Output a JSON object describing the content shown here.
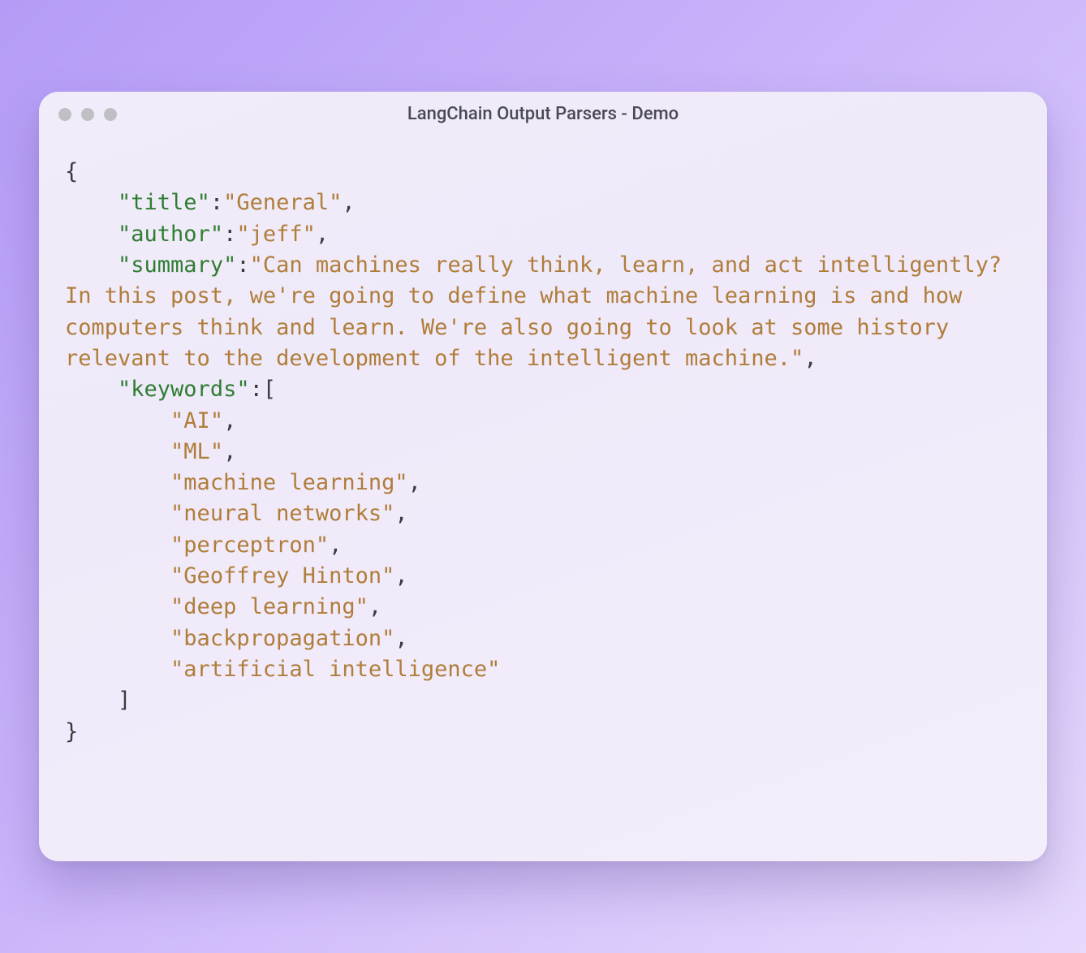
{
  "window": {
    "title": "LangChain Output Parsers - Demo"
  },
  "code": {
    "keys": {
      "title": "\"title\"",
      "author": "\"author\"",
      "summary": "\"summary\"",
      "keywords": "\"keywords\""
    },
    "values": {
      "title": "\"General\"",
      "author": "\"jeff\"",
      "summary": "\"Can machines really think, learn, and act intelligently? In this post, we're going to define what machine learning is and how computers think and learn. We're also going to look at some history relevant to the development of the intelligent machine.\"",
      "keywords": [
        "\"AI\"",
        "\"ML\"",
        "\"machine learning\"",
        "\"neural networks\"",
        "\"perceptron\"",
        "\"Geoffrey Hinton\"",
        "\"deep learning\"",
        "\"backpropagation\"",
        "\"artificial intelligence\""
      ]
    },
    "punct": {
      "open_brace": "{",
      "close_brace": "}",
      "open_bracket": "[",
      "close_bracket": "]",
      "colon": ":",
      "comma": ","
    },
    "indent": {
      "one": "    ",
      "two": "        "
    }
  }
}
